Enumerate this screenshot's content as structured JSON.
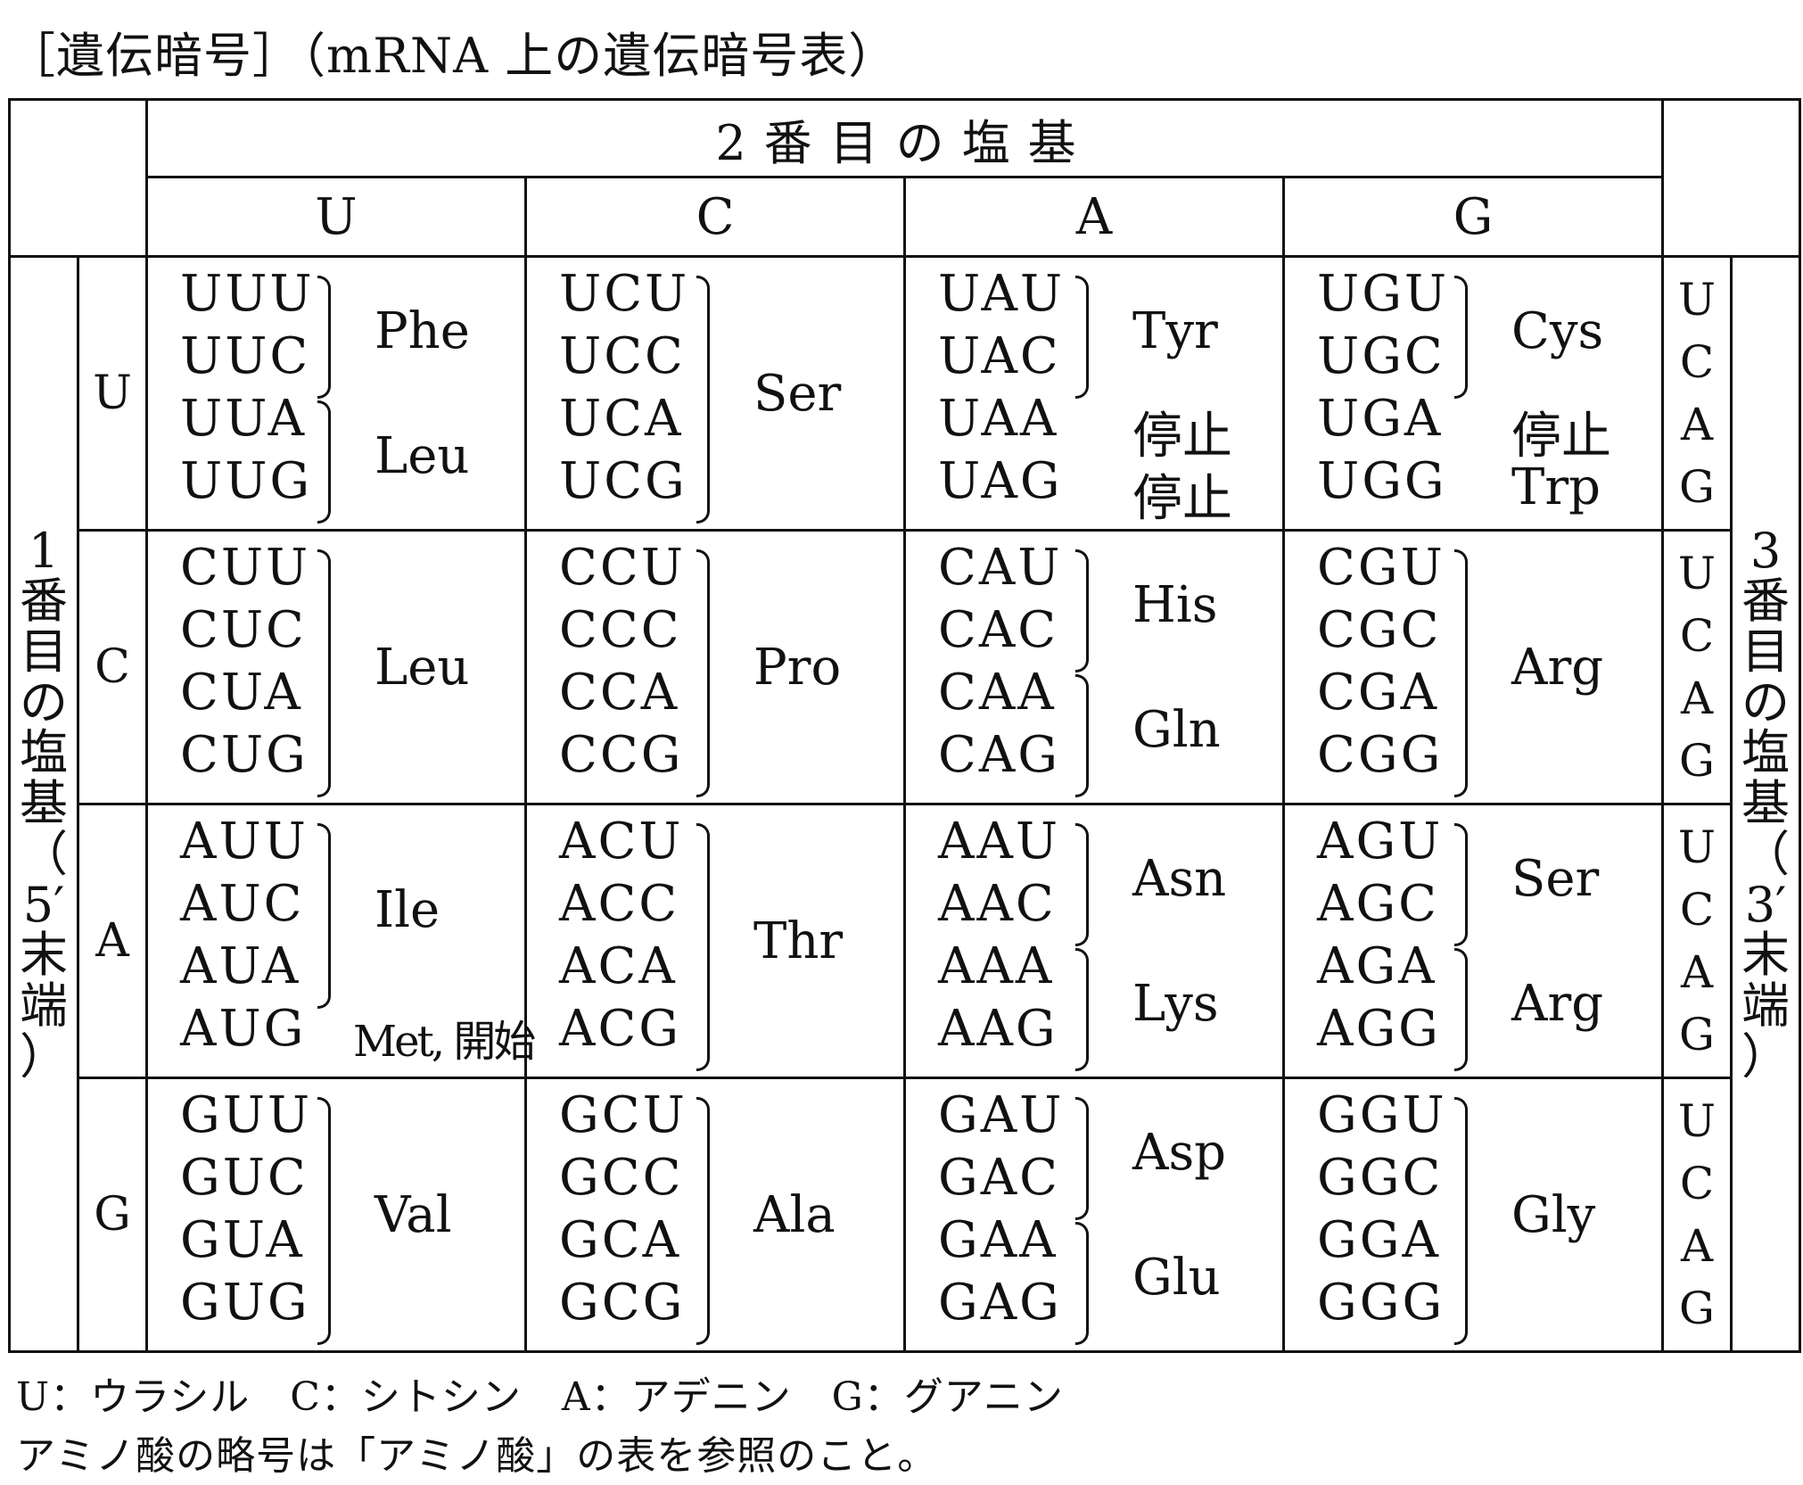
{
  "title": "［遺伝暗号］（mRNA 上の遺伝暗号表）",
  "second_base_header": "2番目の塩基",
  "second_bases": [
    "U",
    "C",
    "A",
    "G"
  ],
  "first_label": "1番目の塩基（5′末端）",
  "first_label_chars": [
    "1",
    "番",
    "目",
    "の",
    "塩",
    "基",
    "（",
    "5′",
    "末",
    "端",
    "）"
  ],
  "third_label": "3番目の塩基（3′末端）",
  "third_label_chars": [
    "3",
    "番",
    "目",
    "の",
    "塩",
    "基",
    "（",
    "3′",
    "末",
    "端",
    "）"
  ],
  "third_bases": [
    "U",
    "C",
    "A",
    "G"
  ],
  "rows": [
    {
      "first": "U",
      "cells": [
        {
          "codons": [
            "UUU",
            "UUC",
            "UUA",
            "UUG"
          ],
          "groups": [
            {
              "label": "Phe",
              "span": [
                0,
                1
              ],
              "bracket": true
            },
            {
              "label": "Leu",
              "span": [
                2,
                3
              ],
              "bracket": true
            }
          ]
        },
        {
          "codons": [
            "UCU",
            "UCC",
            "UCA",
            "UCG"
          ],
          "groups": [
            {
              "label": "Ser",
              "span": [
                0,
                3
              ],
              "bracket": true
            }
          ]
        },
        {
          "codons": [
            "UAU",
            "UAC",
            "UAA",
            "UAG"
          ],
          "groups": [
            {
              "label": "Tyr",
              "span": [
                0,
                1
              ],
              "bracket": true
            },
            {
              "label": "停止",
              "span": [
                2,
                2
              ],
              "bracket": false
            },
            {
              "label": "停止",
              "span": [
                3,
                3
              ],
              "bracket": false
            }
          ]
        },
        {
          "codons": [
            "UGU",
            "UGC",
            "UGA",
            "UGG"
          ],
          "groups": [
            {
              "label": "Cys",
              "span": [
                0,
                1
              ],
              "bracket": true
            },
            {
              "label": "停止",
              "span": [
                2,
                2
              ],
              "bracket": false
            },
            {
              "label": "Trp",
              "span": [
                3,
                3
              ],
              "bracket": false
            }
          ]
        }
      ]
    },
    {
      "first": "C",
      "cells": [
        {
          "codons": [
            "CUU",
            "CUC",
            "CUA",
            "CUG"
          ],
          "groups": [
            {
              "label": "Leu",
              "span": [
                0,
                3
              ],
              "bracket": true
            }
          ]
        },
        {
          "codons": [
            "CCU",
            "CCC",
            "CCA",
            "CCG"
          ],
          "groups": [
            {
              "label": "Pro",
              "span": [
                0,
                3
              ],
              "bracket": true
            }
          ]
        },
        {
          "codons": [
            "CAU",
            "CAC",
            "CAA",
            "CAG"
          ],
          "groups": [
            {
              "label": "His",
              "span": [
                0,
                1
              ],
              "bracket": true
            },
            {
              "label": "Gln",
              "span": [
                2,
                3
              ],
              "bracket": true
            }
          ]
        },
        {
          "codons": [
            "CGU",
            "CGC",
            "CGA",
            "CGG"
          ],
          "groups": [
            {
              "label": "Arg",
              "span": [
                0,
                3
              ],
              "bracket": true
            }
          ]
        }
      ]
    },
    {
      "first": "A",
      "cells": [
        {
          "codons": [
            "AUU",
            "AUC",
            "AUA",
            "AUG"
          ],
          "groups": [
            {
              "label": "Ile",
              "span": [
                0,
                2
              ],
              "bracket": true
            },
            {
              "label": "Met, 開始",
              "span": [
                3,
                3
              ],
              "bracket": false,
              "small": true
            }
          ]
        },
        {
          "codons": [
            "ACU",
            "ACC",
            "ACA",
            "ACG"
          ],
          "groups": [
            {
              "label": "Thr",
              "span": [
                0,
                3
              ],
              "bracket": true
            }
          ]
        },
        {
          "codons": [
            "AAU",
            "AAC",
            "AAA",
            "AAG"
          ],
          "groups": [
            {
              "label": "Asn",
              "span": [
                0,
                1
              ],
              "bracket": true
            },
            {
              "label": "Lys",
              "span": [
                2,
                3
              ],
              "bracket": true
            }
          ]
        },
        {
          "codons": [
            "AGU",
            "AGC",
            "AGA",
            "AGG"
          ],
          "groups": [
            {
              "label": "Ser",
              "span": [
                0,
                1
              ],
              "bracket": true
            },
            {
              "label": "Arg",
              "span": [
                2,
                3
              ],
              "bracket": true
            }
          ]
        }
      ]
    },
    {
      "first": "G",
      "cells": [
        {
          "codons": [
            "GUU",
            "GUC",
            "GUA",
            "GUG"
          ],
          "groups": [
            {
              "label": "Val",
              "span": [
                0,
                3
              ],
              "bracket": true
            }
          ]
        },
        {
          "codons": [
            "GCU",
            "GCC",
            "GCA",
            "GCG"
          ],
          "groups": [
            {
              "label": "Ala",
              "span": [
                0,
                3
              ],
              "bracket": true
            }
          ]
        },
        {
          "codons": [
            "GAU",
            "GAC",
            "GAA",
            "GAG"
          ],
          "groups": [
            {
              "label": "Asp",
              "span": [
                0,
                1
              ],
              "bracket": true
            },
            {
              "label": "Glu",
              "span": [
                2,
                3
              ],
              "bracket": true
            }
          ]
        },
        {
          "codons": [
            "GGU",
            "GGC",
            "GGA",
            "GGG"
          ],
          "groups": [
            {
              "label": "Gly",
              "span": [
                0,
                3
              ],
              "bracket": true
            }
          ]
        }
      ]
    }
  ],
  "legend_bases": "U：ウラシル　C：シトシン　A：アデニン　G：グアニン",
  "legend_note": "アミノ酸の略号は「アミノ酸」の表を参照のこと。"
}
